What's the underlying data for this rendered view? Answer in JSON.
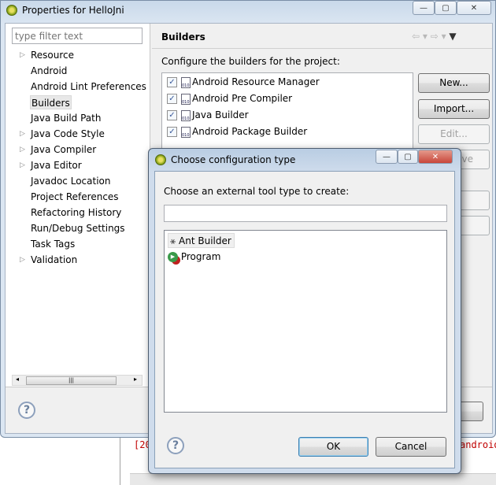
{
  "window": {
    "title": "Properties for HelloJni"
  },
  "filter": {
    "placeholder": "type filter text"
  },
  "tree": [
    {
      "label": "Resource",
      "expandable": true
    },
    {
      "label": "Android",
      "expandable": false
    },
    {
      "label": "Android Lint Preferences",
      "expandable": false
    },
    {
      "label": "Builders",
      "expandable": false,
      "selected": true
    },
    {
      "label": "Java Build Path",
      "expandable": false
    },
    {
      "label": "Java Code Style",
      "expandable": true
    },
    {
      "label": "Java Compiler",
      "expandable": true
    },
    {
      "label": "Java Editor",
      "expandable": true
    },
    {
      "label": "Javadoc Location",
      "expandable": false
    },
    {
      "label": "Project References",
      "expandable": false
    },
    {
      "label": "Refactoring History",
      "expandable": false
    },
    {
      "label": "Run/Debug Settings",
      "expandable": false
    },
    {
      "label": "Task Tags",
      "expandable": false
    },
    {
      "label": "Validation",
      "expandable": true
    }
  ],
  "page": {
    "title": "Builders",
    "description": "Configure the builders for the project:",
    "builders": [
      {
        "label": "Android Resource Manager",
        "checked": true
      },
      {
        "label": "Android Pre Compiler",
        "checked": true
      },
      {
        "label": "Java Builder",
        "checked": true
      },
      {
        "label": "Android Package Builder",
        "checked": true
      }
    ],
    "buttons": {
      "new": "New...",
      "import": "Import...",
      "edit": "Edit...",
      "remove_partial": "ve"
    }
  },
  "console": {
    "left_text": "[20",
    "right_text": "android"
  },
  "dialog": {
    "title": "Choose configuration type",
    "prompt": "Choose an external tool type to create:",
    "filter_value": "",
    "items": [
      {
        "label": "Ant Builder",
        "icon": "ant-icon"
      },
      {
        "label": "Program",
        "icon": "program-icon"
      }
    ],
    "ok": "OK",
    "cancel": "Cancel"
  },
  "colors": {
    "close_button": "#c9463a",
    "console_error": "#c00000"
  }
}
